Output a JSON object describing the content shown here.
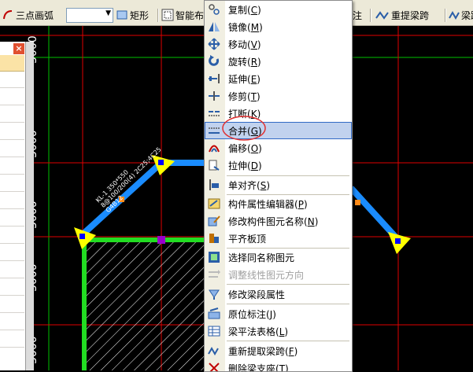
{
  "toolbar": {
    "arc_tool": "三点画弧",
    "rect_tool": "矩形",
    "smart_layout": "智能布",
    "partial_right": "注",
    "re_extract": "重提梁跨",
    "beam_partial": "梁跨"
  },
  "canvas": {
    "dimension_labels": [
      "3000",
      "3000",
      "3000",
      "3000",
      "3000"
    ],
    "beam_annotation_line1": "KL-1 350*550",
    "beam_annotation_line2": "8@100/200(4) 2C25;4C25",
    "beam_annotation_line3": "G4B12"
  },
  "menu": {
    "items": [
      {
        "label": "复制",
        "key": "C"
      },
      {
        "label": "镜像",
        "key": "M"
      },
      {
        "label": "移动",
        "key": "V"
      },
      {
        "label": "旋转",
        "key": "R"
      },
      {
        "label": "延伸",
        "key": "E"
      },
      {
        "label": "修剪",
        "key": "T"
      },
      {
        "label": "打断",
        "key": "K"
      },
      {
        "label": "合并",
        "key": "G"
      },
      {
        "label": "偏移",
        "key": "O"
      },
      {
        "label": "拉伸",
        "key": "D"
      },
      {
        "label": "单对齐",
        "key": "S"
      },
      {
        "label": "构件属性编辑器",
        "key": "P"
      },
      {
        "label": "修改构件图元名称",
        "key": "N"
      },
      {
        "label": "平齐板顶",
        "key": ""
      },
      {
        "label": "选择同名称图元",
        "key": ""
      },
      {
        "label": "调整线性图元方向",
        "key": ""
      },
      {
        "label": "修改梁段属性",
        "key": ""
      },
      {
        "label": "原位标注",
        "key": "J"
      },
      {
        "label": "梁平法表格",
        "key": "L"
      },
      {
        "label": "重新提取梁跨",
        "key": "F"
      },
      {
        "label": "删除梁支座",
        "key": "T"
      }
    ]
  },
  "colors": {
    "highlight": "#c1d2ee",
    "beam_blue": "#1a8cff",
    "grid_red": "#e00000",
    "grid_green": "#00c000"
  }
}
